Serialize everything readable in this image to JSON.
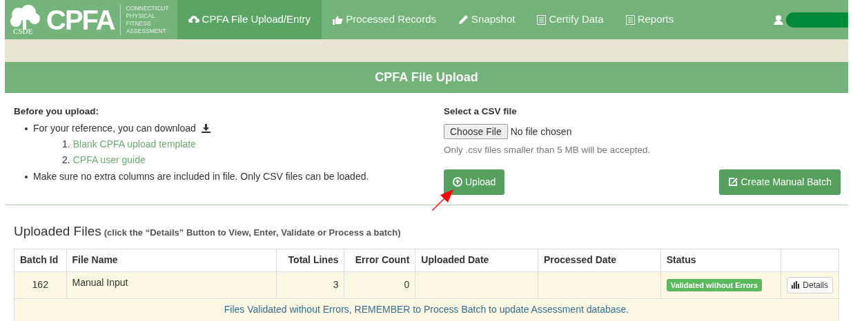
{
  "logo": {
    "seal": "CSDE",
    "wordmark": "CPFA",
    "subtitle": [
      "CONNECTICUT",
      "PHYSICAL",
      "FITNESS",
      "ASSESSMENT"
    ]
  },
  "nav": [
    {
      "label": "CPFA File Upload/Entry",
      "selected": true
    },
    {
      "label": "Processed Records",
      "selected": false
    },
    {
      "label": "Snapshot",
      "selected": false
    },
    {
      "label": "Certify Data",
      "selected": false
    },
    {
      "label": "Reports",
      "selected": false
    }
  ],
  "page_title": "CPFA File Upload",
  "instructions": {
    "heading": "Before you upload:",
    "bullets": [
      {
        "text": "For your reference, you can download",
        "links": [
          {
            "number": "1.",
            "text": "Blank CPFA upload template"
          },
          {
            "number": "2.",
            "text": "CPFA user guide"
          }
        ]
      },
      {
        "text": "Make sure no extra columns are included in file. Only CSV files can be loaded."
      }
    ]
  },
  "file_select": {
    "label": "Select a CSV file",
    "button": "Choose File",
    "value": "No file chosen",
    "help": "Only .csv files smaller than 5 MB will be accepted."
  },
  "upload_button": "Upload",
  "manual_batch_button": "Create Manual Batch",
  "uploaded": {
    "title": "Uploaded Files",
    "hint": "(click the “Details” Button to View, Enter, Validate or Process a batch)",
    "columns": [
      "Batch Id",
      "File Name",
      "Total Lines",
      "Error Count",
      "Uploaded Date",
      "Processed Date",
      "Status"
    ],
    "rows": [
      {
        "batch_id": "162",
        "file_name": "Manual Input",
        "total_lines": "3",
        "error_count": "0",
        "status": "Validated without Errors",
        "action": "Details"
      }
    ],
    "message": "Files Validated without Errors, REMEMBER to Process Batch to update Assessment database."
  }
}
